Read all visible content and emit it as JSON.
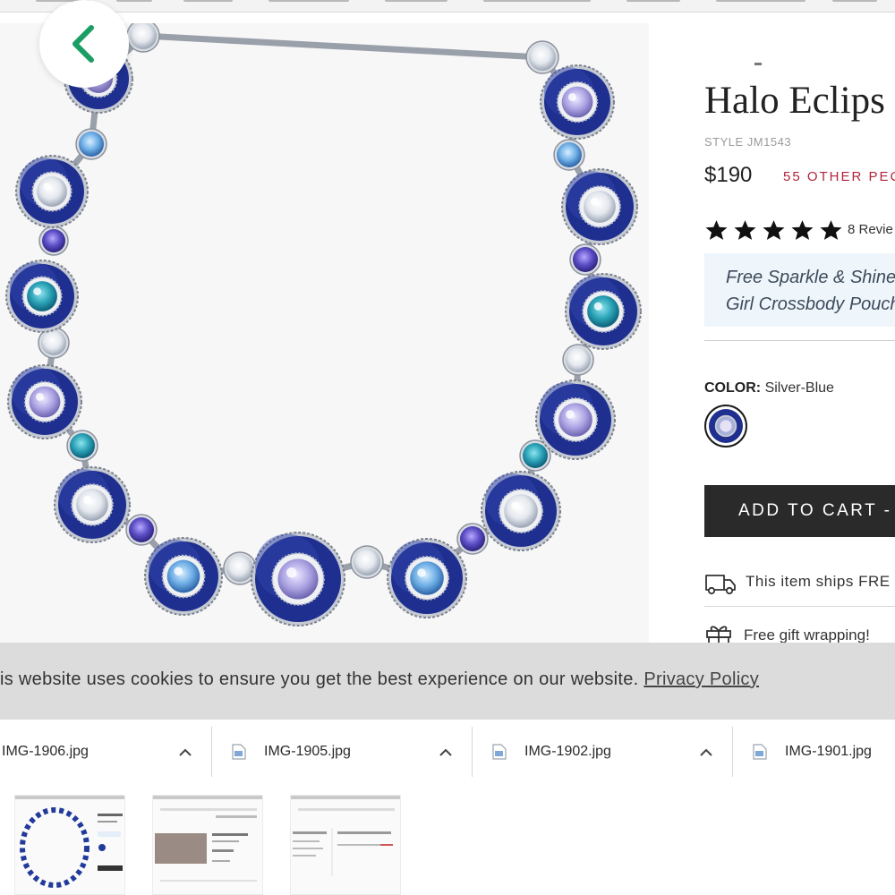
{
  "product": {
    "title": "Halo Eclips",
    "style_code": "STYLE JM1543",
    "price": "$190",
    "other_peeps": "55 OTHER PEC",
    "rating_stars": 5,
    "reviews_label": "8 Revie",
    "promo_line1": "Free Sparkle & Shine",
    "promo_line2": "Girl Crossbody Pouch",
    "color_label": "COLOR:",
    "color_value": "Silver-Blue",
    "add_to_cart": "ADD TO CART - $",
    "ships_text": "This item ships FRE",
    "gift_text": "Free gift wrapping!"
  },
  "cookie": {
    "message": "is website uses cookies to ensure you get the best experience on our website.",
    "privacy_link": "Privacy Policy"
  },
  "downloads": [
    {
      "name": "IMG-1906.jpg"
    },
    {
      "name": "IMG-1905.jpg"
    },
    {
      "name": "IMG-1902.jpg"
    },
    {
      "name": "IMG-1901.jpg"
    }
  ],
  "colors": {
    "accent_green": "#1a9e63",
    "peeps_red": "#b0263c",
    "cart_bg": "#2a2a2a",
    "banner_bg": "#dcdcdc",
    "enamel_blue": "#1f2f8f"
  },
  "icons": {
    "back": "chevron-left-icon",
    "share": "share-icon",
    "wishlist": "heart-icon",
    "star": "star-icon",
    "shipping": "truck-icon",
    "gift": "gift-icon",
    "file": "file-icon",
    "chevron": "chevron-up-icon"
  }
}
